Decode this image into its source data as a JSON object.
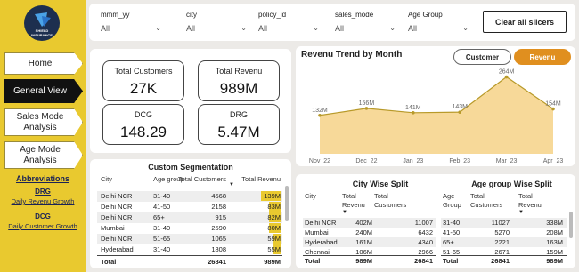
{
  "brand": {
    "accent": "#e9c92f",
    "logo_text": "SHIELD INSURANCE",
    "logo_line1": "SHIELD",
    "logo_line2": "INSURANCE"
  },
  "sidebar": {
    "nav": [
      {
        "label": "Home",
        "active": false
      },
      {
        "label": "General View",
        "active": true
      },
      {
        "label": "Sales Mode Analysis",
        "line1": "Sales Mode",
        "line2": "Analysis",
        "active": false
      },
      {
        "label": "Age Mode Analysis",
        "line1": "Age Mode",
        "line2": "Analysis",
        "active": false
      }
    ],
    "abbreviations_title": "Abbreviations",
    "abbreviations": [
      {
        "key": "DRG",
        "value": "Daily Revenu Growth"
      },
      {
        "key": "DCG",
        "value": "Daily Customer Growth"
      }
    ]
  },
  "slicers": [
    {
      "label": "mmm_yy",
      "value": "All"
    },
    {
      "label": "city",
      "value": "All"
    },
    {
      "label": "policy_id",
      "value": "All"
    },
    {
      "label": "sales_mode",
      "value": "All"
    },
    {
      "label": "Age Group",
      "value": "All"
    }
  ],
  "clear_button": "Clear all slicers",
  "kpis": [
    {
      "label": "Total Customers",
      "value": "27K"
    },
    {
      "label": "Total Revenu",
      "value": "989M"
    },
    {
      "label": "DCG",
      "value": "148.29"
    },
    {
      "label": "DRG",
      "value": "5.47M"
    }
  ],
  "revenue_chart": {
    "title": "Revenu Trend by Month",
    "toggles": [
      {
        "label": "Customer",
        "active": false
      },
      {
        "label": "Revenu",
        "active": true
      }
    ],
    "chart_data": {
      "type": "area",
      "categories": [
        "Nov_22",
        "Dec_22",
        "Jan_23",
        "Feb_23",
        "Mar_23",
        "Apr_23"
      ],
      "values": [
        132,
        156,
        141,
        143,
        264,
        154
      ],
      "data_labels": [
        "132M",
        "156M",
        "141M",
        "143M",
        "264M",
        "154M"
      ],
      "ylim": [
        0,
        290
      ],
      "fill_color": "#f7d999",
      "line_color": "#b89a2a"
    }
  },
  "segmentation": {
    "title": "Custom Segmentation",
    "columns": [
      "City",
      "Age group",
      "Total Customers",
      "Total Revenu"
    ],
    "rows": [
      {
        "city": "Delhi NCR",
        "age": "31-40",
        "customers": "4568",
        "revenue": "139M",
        "rev_value": 139
      },
      {
        "city": "Delhi NCR",
        "age": "41-50",
        "customers": "2158",
        "revenue": "83M",
        "rev_value": 83
      },
      {
        "city": "Delhi NCR",
        "age": "65+",
        "customers": "915",
        "revenue": "82M",
        "rev_value": 82
      },
      {
        "city": "Mumbai",
        "age": "31-40",
        "customers": "2590",
        "revenue": "80M",
        "rev_value": 80
      },
      {
        "city": "Delhi NCR",
        "age": "51-65",
        "customers": "1065",
        "revenue": "59M",
        "rev_value": 59
      },
      {
        "city": "Hyderabad",
        "age": "31-40",
        "customers": "1808",
        "revenue": "55M",
        "rev_value": 55
      }
    ],
    "total": {
      "label": "Total",
      "customers": "26841",
      "revenue": "989M"
    }
  },
  "city_split": {
    "title": "City Wise Split",
    "columns": [
      "City",
      "Total Revenu",
      "Total Customers"
    ],
    "rows": [
      {
        "city": "Delhi NCR",
        "revenue": "402M",
        "customers": "11007"
      },
      {
        "city": "Mumbai",
        "revenue": "240M",
        "customers": "6432"
      },
      {
        "city": "Hyderabad",
        "revenue": "161M",
        "customers": "4340"
      },
      {
        "city": "Chennai",
        "revenue": "106M",
        "customers": "2966"
      }
    ],
    "total": {
      "label": "Total",
      "revenue": "989M",
      "customers": "26841"
    }
  },
  "age_split": {
    "title": "Age group Wise Split",
    "columns": [
      "Age Group",
      "Total Customers",
      "Total Revenu"
    ],
    "rows": [
      {
        "age": "31-40",
        "customers": "11027",
        "revenue": "338M"
      },
      {
        "age": "41-50",
        "customers": "5270",
        "revenue": "208M"
      },
      {
        "age": "65+",
        "customers": "2221",
        "revenue": "163M"
      },
      {
        "age": "51-65",
        "customers": "2671",
        "revenue": "159M"
      }
    ],
    "total": {
      "label": "Total",
      "customers": "26841",
      "revenue": "989M"
    }
  }
}
